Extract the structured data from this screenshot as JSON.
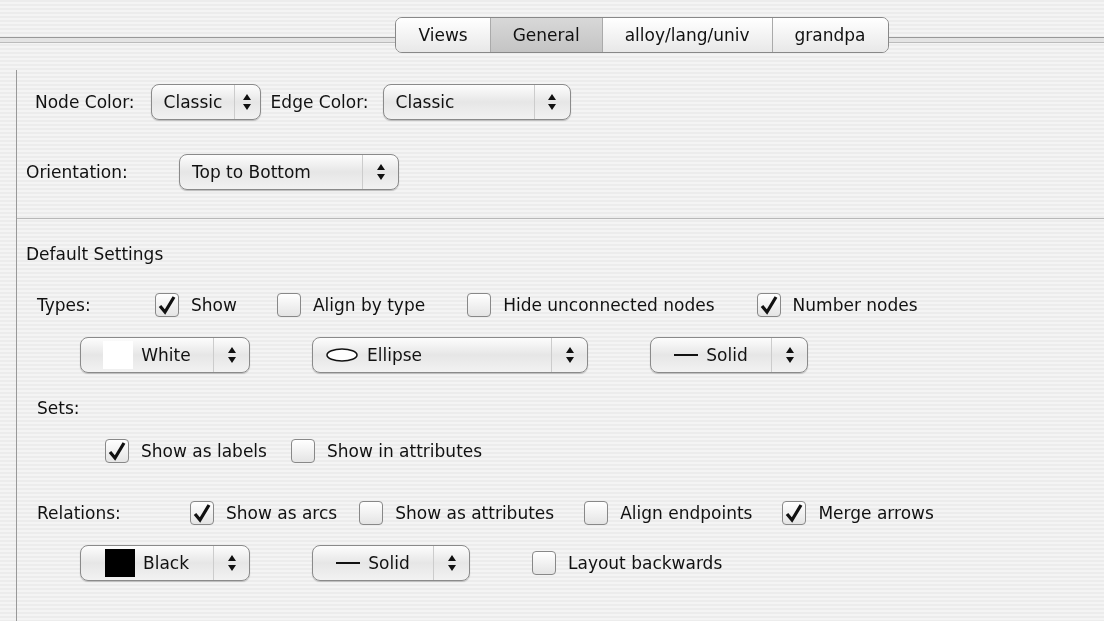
{
  "tabs": [
    {
      "label": "Views",
      "selected": false
    },
    {
      "label": "General",
      "selected": true
    },
    {
      "label": "alloy/lang/univ",
      "selected": false
    },
    {
      "label": "grandpa",
      "selected": false
    }
  ],
  "node_color": {
    "label": "Node Color:",
    "value": "Classic"
  },
  "edge_color": {
    "label": "Edge Color:",
    "value": "Classic"
  },
  "orientation": {
    "label": "Orientation:",
    "value": "Top to Bottom"
  },
  "default_settings": {
    "title": "Default Settings"
  },
  "types": {
    "label": "Types:",
    "options": [
      {
        "label": "Show",
        "checked": true
      },
      {
        "label": "Align by type",
        "checked": false
      },
      {
        "label": "Hide unconnected nodes",
        "checked": false
      },
      {
        "label": "Number nodes",
        "checked": true
      }
    ],
    "selects": [
      {
        "kind": "color",
        "value": "White",
        "color": "#ffffff"
      },
      {
        "kind": "shape",
        "value": "Ellipse"
      },
      {
        "kind": "line",
        "value": "Solid"
      }
    ]
  },
  "sets": {
    "label": "Sets:",
    "options": [
      {
        "label": "Show as labels",
        "checked": true
      },
      {
        "label": "Show in attributes",
        "checked": false
      }
    ]
  },
  "relations": {
    "label": "Relations:",
    "options": [
      {
        "label": "Show as arcs",
        "checked": true
      },
      {
        "label": "Show as attributes",
        "checked": false
      },
      {
        "label": "Align endpoints",
        "checked": false
      },
      {
        "label": "Merge arrows",
        "checked": true
      }
    ],
    "selects": [
      {
        "kind": "color",
        "value": "Black",
        "color": "#000000"
      },
      {
        "kind": "line",
        "value": "Solid"
      }
    ],
    "extra_options": [
      {
        "label": "Layout backwards",
        "checked": false
      }
    ]
  }
}
